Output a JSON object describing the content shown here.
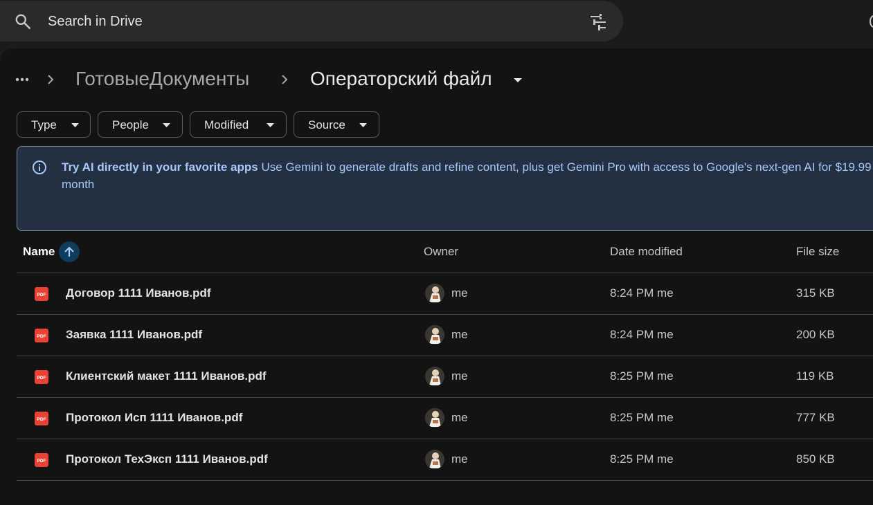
{
  "search": {
    "placeholder": "Search in Drive"
  },
  "breadcrumb": {
    "folder": "ГотовыеДокументы",
    "current": "Операторский файл"
  },
  "filters": [
    {
      "label": "Type"
    },
    {
      "label": "People"
    },
    {
      "label": "Modified"
    },
    {
      "label": "Source"
    }
  ],
  "banner": {
    "title": "Try AI directly in your favorite apps",
    "body": " Use Gemini to generate drafts and refine content, plus get Gemini Pro with access to Google's next-gen AI for $19.99",
    "body_wrap": "month"
  },
  "table": {
    "headers": {
      "name": "Name",
      "owner": "Owner",
      "modified": "Date modified",
      "size": "File size"
    },
    "rows": [
      {
        "name": "Договор 1111 Иванов.pdf",
        "owner": "me",
        "modified": "8:24 PM me",
        "size": "315 KB"
      },
      {
        "name": "Заявка 1111 Иванов.pdf",
        "owner": "me",
        "modified": "8:24 PM me",
        "size": "200 KB"
      },
      {
        "name": "Клиентский макет 1111 Иванов.pdf",
        "owner": "me",
        "modified": "8:25 PM me",
        "size": "119 KB"
      },
      {
        "name": "Протокол Исп 1111 Иванов.pdf",
        "owner": "me",
        "modified": "8:25 PM me",
        "size": "777 KB"
      },
      {
        "name": "Протокол ТехЭксп 1111 Иванов.pdf",
        "owner": "me",
        "modified": "8:25 PM me",
        "size": "850 KB"
      }
    ]
  },
  "colors": {
    "accent": "#a8c7fa",
    "pdf_red": "#ea4335",
    "sort_bg": "#0e3d5c"
  },
  "icons": {
    "search": "search-icon",
    "tune": "tune-icon",
    "more": "more-horiz-icon",
    "chevron": "chevron-right-icon",
    "caret": "arrow-drop-down-icon",
    "info": "info-icon",
    "sort": "arrow-upward-icon",
    "pdf": "pdf-icon"
  }
}
